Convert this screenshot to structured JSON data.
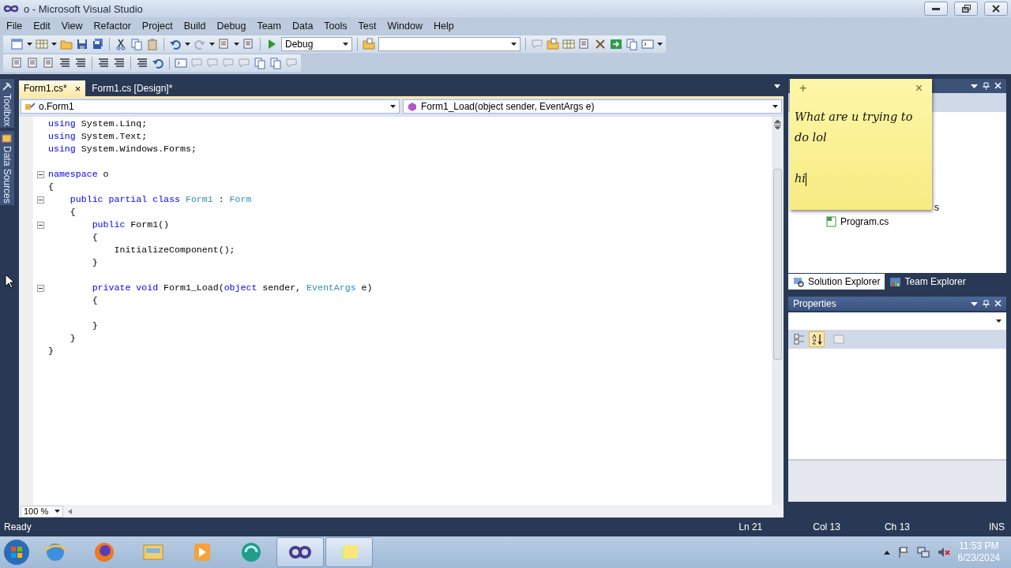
{
  "window": {
    "title": "o - Microsoft Visual Studio"
  },
  "menu": [
    "File",
    "Edit",
    "View",
    "Refactor",
    "Project",
    "Build",
    "Debug",
    "Team",
    "Data",
    "Tools",
    "Test",
    "Window",
    "Help"
  ],
  "toolbar": {
    "configuration": "Debug"
  },
  "tabs": [
    {
      "label": "Form1.cs*",
      "selected": true,
      "close": "×"
    },
    {
      "label": "Form1.cs [Design]*",
      "selected": false
    }
  ],
  "nav": {
    "type_scope": "o.Form1",
    "member": "Form1_Load(object sender, EventArgs e)"
  },
  "side_strip": [
    {
      "label": "Toolbox",
      "kind": "toolbox"
    },
    {
      "label": "Data Sources",
      "kind": "data"
    }
  ],
  "code": [
    {
      "kind": "code",
      "fold": false,
      "tokens": [
        {
          "kind": "keyword",
          "text": "using"
        },
        {
          "kind": "plain",
          "text": " System.Linq;"
        }
      ]
    },
    {
      "kind": "code",
      "fold": false,
      "tokens": [
        {
          "kind": "keyword",
          "text": "using"
        },
        {
          "kind": "plain",
          "text": " System.Text;"
        }
      ]
    },
    {
      "kind": "code",
      "fold": false,
      "tokens": [
        {
          "kind": "keyword",
          "text": "using"
        },
        {
          "kind": "plain",
          "text": " System.Windows.Forms;"
        }
      ]
    },
    {
      "kind": "blank"
    },
    {
      "kind": "code",
      "fold": true,
      "tokens": [
        {
          "kind": "keyword",
          "text": "namespace"
        },
        {
          "kind": "plain",
          "text": " o"
        }
      ]
    },
    {
      "kind": "code",
      "fold": false,
      "tokens": [
        {
          "kind": "plain",
          "text": "{"
        }
      ]
    },
    {
      "kind": "code",
      "fold": true,
      "tokens": [
        {
          "kind": "keyword",
          "text": "    public partial class "
        },
        {
          "kind": "type",
          "text": "Form1"
        },
        {
          "kind": "plain",
          "text": " : "
        },
        {
          "kind": "type",
          "text": "Form"
        }
      ]
    },
    {
      "kind": "code",
      "fold": false,
      "tokens": [
        {
          "kind": "plain",
          "text": "    {"
        }
      ]
    },
    {
      "kind": "code",
      "fold": true,
      "tokens": [
        {
          "kind": "keyword",
          "text": "        public"
        },
        {
          "kind": "plain",
          "text": " Form1()"
        }
      ]
    },
    {
      "kind": "code",
      "fold": false,
      "tokens": [
        {
          "kind": "plain",
          "text": "        {"
        }
      ]
    },
    {
      "kind": "code",
      "fold": false,
      "tokens": [
        {
          "kind": "plain",
          "text": "            InitializeComponent();"
        }
      ]
    },
    {
      "kind": "code",
      "fold": false,
      "tokens": [
        {
          "kind": "plain",
          "text": "        }"
        }
      ]
    },
    {
      "kind": "blank"
    },
    {
      "kind": "code",
      "fold": true,
      "tokens": [
        {
          "kind": "keyword",
          "text": "        private void"
        },
        {
          "kind": "plain",
          "text": " Form1_Load("
        },
        {
          "kind": "keyword",
          "text": "object"
        },
        {
          "kind": "plain",
          "text": " sender, "
        },
        {
          "kind": "type",
          "text": "EventArgs"
        },
        {
          "kind": "plain",
          "text": " e)"
        }
      ]
    },
    {
      "kind": "code",
      "fold": false,
      "tokens": [
        {
          "kind": "plain",
          "text": "        {"
        }
      ]
    },
    {
      "kind": "blank"
    },
    {
      "kind": "code",
      "fold": false,
      "tokens": [
        {
          "kind": "plain",
          "text": "        }"
        }
      ]
    },
    {
      "kind": "code",
      "fold": false,
      "tokens": [
        {
          "kind": "plain",
          "text": "    }"
        }
      ]
    },
    {
      "kind": "code",
      "fold": false,
      "tokens": [
        {
          "kind": "plain",
          "text": "}"
        }
      ]
    }
  ],
  "zoom": "100 %",
  "solution_explorer": {
    "items": [
      {
        "label": "s",
        "kind": "partial"
      },
      {
        "label": "Program.cs",
        "kind": "file"
      }
    ]
  },
  "panel_tabs": [
    {
      "label": "Solution Explorer",
      "selected": true,
      "kind": "solution"
    },
    {
      "label": "Team Explorer",
      "selected": false,
      "kind": "team"
    }
  ],
  "properties": {
    "title": "Properties",
    "sort": [
      {
        "kind": "categorized",
        "selected": false
      },
      {
        "kind": "alphabetical",
        "selected": true
      }
    ]
  },
  "sticky_note": {
    "add": "+",
    "close": "×",
    "paragraphs": [
      "What are u trying to do lol",
      "hi"
    ]
  },
  "status": {
    "message": "Ready",
    "line": "Ln 21",
    "column": "Col 13",
    "char": "Ch 13",
    "mode": "INS"
  },
  "taskbar": {
    "apps": [
      {
        "kind": "browser",
        "selected": false
      },
      {
        "kind": "fox",
        "selected": false
      },
      {
        "kind": "folder",
        "selected": false
      },
      {
        "kind": "media",
        "selected": false
      },
      {
        "kind": "green",
        "selected": false
      },
      {
        "kind": "infinity",
        "selected": true
      },
      {
        "kind": "notes",
        "selected": true
      }
    ],
    "time": "11:53 PM",
    "date": "6/23/2024"
  }
}
